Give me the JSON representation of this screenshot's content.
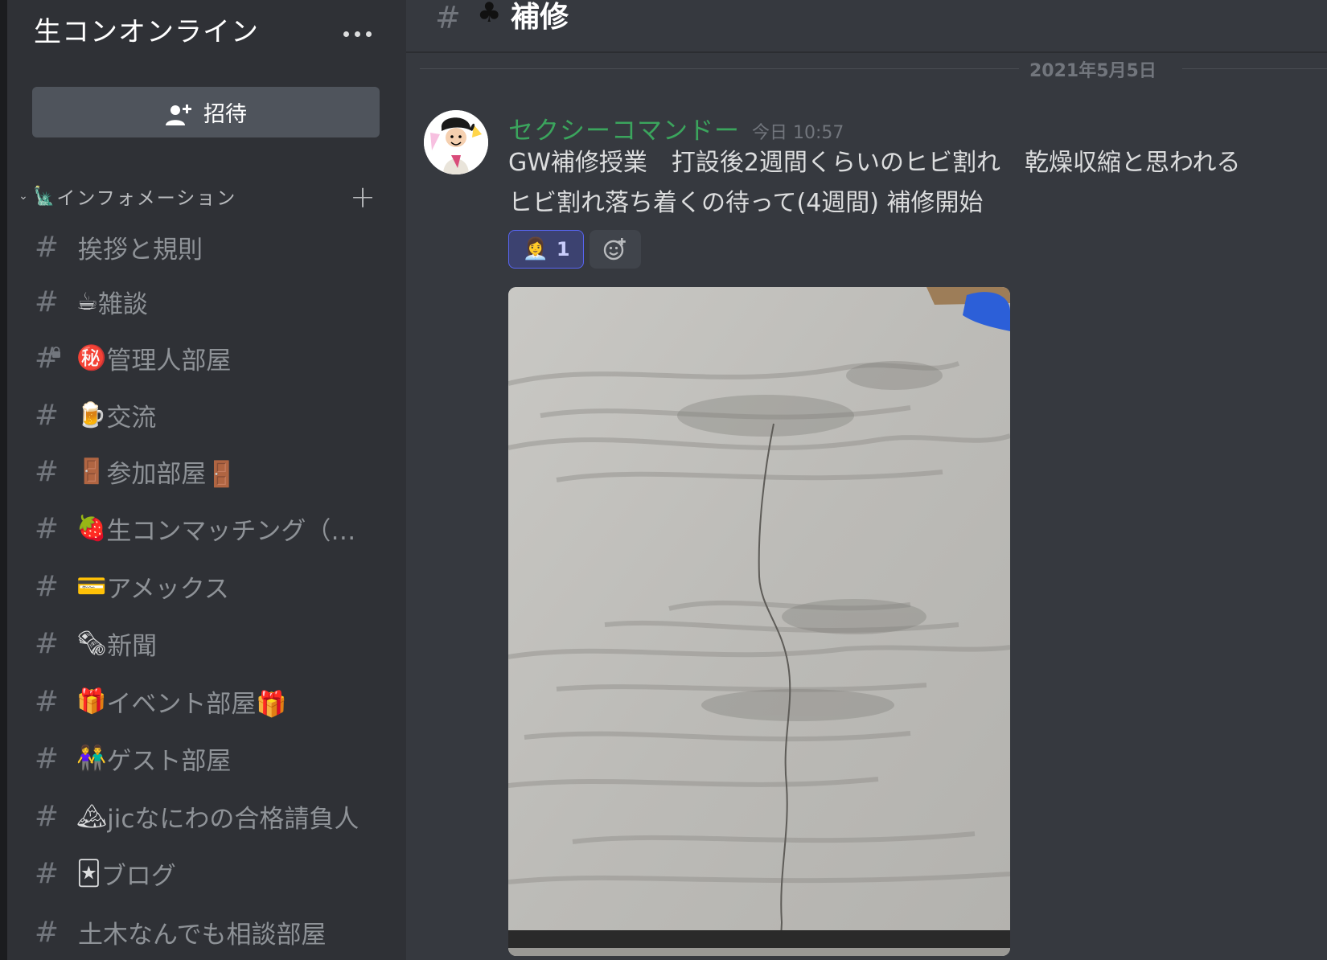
{
  "server": {
    "name": "生コンオンライン",
    "invite_label": "招待"
  },
  "category": {
    "chevron": "⌄",
    "emoji": "🗽",
    "name": "インフォメーション",
    "add": "+"
  },
  "channels": [
    {
      "emoji": "",
      "name": "挨拶と規則",
      "locked": false
    },
    {
      "emoji": "☕",
      "name": "雑談",
      "locked": false
    },
    {
      "emoji": "㊙️",
      "name": "管理人部屋",
      "locked": true
    },
    {
      "emoji": "🍺",
      "name": "交流",
      "locked": false
    },
    {
      "emoji": "🚪",
      "name": "参加部屋🚪",
      "locked": false
    },
    {
      "emoji": "🍓",
      "name": "生コンマッチング（…",
      "locked": false
    },
    {
      "emoji": "💳",
      "name": "アメックス",
      "locked": false
    },
    {
      "emoji": "🗞",
      "name": "新聞",
      "locked": false
    },
    {
      "emoji": "🎁",
      "name": "イベント部屋🎁",
      "locked": false
    },
    {
      "emoji": "👫",
      "name": "ゲスト部屋",
      "locked": false
    },
    {
      "emoji": "🏔",
      "name": "jicなにわの合格請負人",
      "locked": false
    },
    {
      "emoji": "🃏",
      "name": "ブログ",
      "locked": false
    },
    {
      "emoji": "",
      "name": "土木なんでも相談部屋",
      "locked": false
    }
  ],
  "header": {
    "hash": "#",
    "channel_emoji": "♣",
    "channel_name": "補修"
  },
  "date_separator": "2021年5月5日",
  "message": {
    "author": "セクシーコマンドー",
    "timestamp": "今日 10:57",
    "line1": "GW補修授業　打設後2週間くらいのヒビ割れ　乾燥収縮と思われる",
    "line2": "ヒビ割れ落ち着くの待って(4週間) 補修開始",
    "reaction_emoji": "👩‍💼",
    "reaction_count": "1"
  },
  "icons": [
    "more-dots-icon",
    "add-user-icon",
    "chevron-down-icon",
    "plus-icon",
    "hash-icon",
    "lock-icon",
    "add-reaction-icon"
  ],
  "colors": {
    "sidebar": "#2f3136",
    "main": "#36393f",
    "author": "#3ba55d",
    "reaction_border": "#5865f2"
  }
}
